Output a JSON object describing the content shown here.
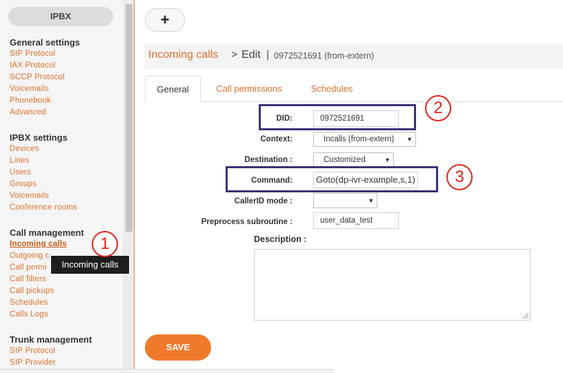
{
  "sidebar": {
    "ipbx_button": "IPBX",
    "sections": [
      {
        "title": "General settings",
        "items": [
          "SIP Protocol",
          "IAX Protocol",
          "SCCP Protocol",
          "Voicemails",
          "Phonebook",
          "Advanced"
        ]
      },
      {
        "title": "IPBX settings",
        "items": [
          "Devices",
          "Lines",
          "Users",
          "Groups",
          "Voicemails",
          "Conference rooms"
        ]
      },
      {
        "title": "Call management",
        "items": [
          "Incoming calls",
          "Outgoing calls",
          "Call permissions",
          "Call filters",
          "Call pickups",
          "Schedules",
          "Calls Logs"
        ]
      },
      {
        "title": "Trunk management",
        "items": [
          "SIP Protocol",
          "SIP Provider"
        ]
      }
    ],
    "active_item": "Incoming calls",
    "tooltip": "Incoming calls",
    "visible_truncated": {
      "outgoing": "Outgoing c",
      "callperm": "Call permi"
    }
  },
  "annotations": [
    "1",
    "2",
    "3"
  ],
  "toolbar": {
    "add_label": "+"
  },
  "breadcrumb": {
    "section": "Incoming calls",
    "separator": ">",
    "action": "Edit",
    "pipe": "|",
    "record": "0972521691 (from-extern)"
  },
  "tabs": [
    "General",
    "Call permissions",
    "Schedules"
  ],
  "form": {
    "did_label": "DID:",
    "did_value": "0972521691",
    "context_label": "Context:",
    "context_value": "Incalls (from-extern)",
    "destination_label": "Destination :",
    "destination_value": "Customized",
    "command_label": "Command:",
    "command_value": "Goto(dp-ivr-example,s,1)",
    "callerid_label": "CallerID mode :",
    "callerid_value": "",
    "preprocess_label": "Preprocess subroutine :",
    "preprocess_value": "user_data_test",
    "description_label": "Description :",
    "description_value": ""
  },
  "save_label": "SAVE",
  "colors": {
    "accent": "#e0702a",
    "save": "#f07a2c",
    "highlight_box": "#3c3177",
    "annotation": "#e2231a"
  }
}
